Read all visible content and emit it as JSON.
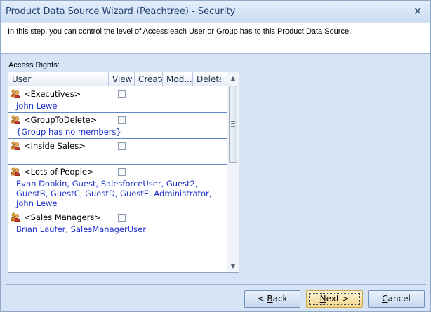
{
  "window": {
    "title": "Product Data Source Wizard (Peachtree) - Security",
    "close_glyph": "✕"
  },
  "intro": {
    "text": "In this step, you can control the level of Access each User or Group has to this Product Data Source."
  },
  "access_rights": {
    "label": "Access Rights:",
    "columns": [
      "User",
      "View",
      "Create",
      "Mod...",
      "Delete"
    ],
    "rows": [
      {
        "group": "<Executives>",
        "members": "John Lewe",
        "view_checked": false
      },
      {
        "group": "<GroupToDelete>",
        "members": "{Group has no members}",
        "view_checked": false
      },
      {
        "group": "<Inside Sales>",
        "members": "",
        "view_checked": false
      },
      {
        "group": "<Lots of People>",
        "members": "Evan Dobkin, Guest, SalesforceUser, Guest2, GuestB, GuestC, GuestD, GuestE, Administrator, John Lewe",
        "view_checked": false
      },
      {
        "group": "<Sales Managers>",
        "members": "Brian Laufer, SalesManagerUser",
        "view_checked": false
      }
    ]
  },
  "buttons": {
    "back_prefix": "< ",
    "back_key": "B",
    "back_rest": "ack",
    "next_key": "N",
    "next_rest": "ext >",
    "cancel_key": "C",
    "cancel_rest": "ancel"
  },
  "colors": {
    "member_text": "#1c2fc9",
    "row_divider": "#5e87c4",
    "window_bg": "#d6e4f5"
  },
  "icons": {
    "group": "group-users-icon",
    "scroll_up": "scroll-up-arrow-icon",
    "scroll_down": "scroll-down-arrow-icon"
  }
}
